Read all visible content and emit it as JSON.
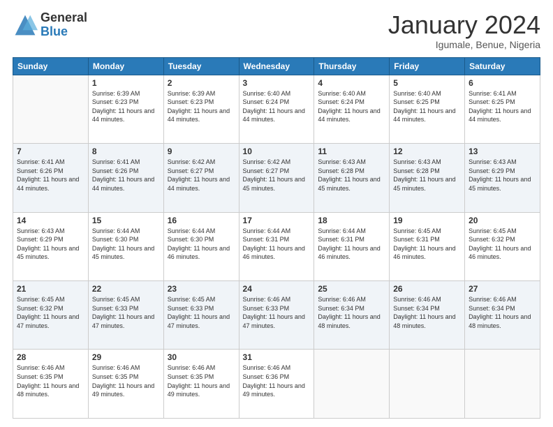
{
  "logo": {
    "general": "General",
    "blue": "Blue"
  },
  "header": {
    "month": "January 2024",
    "location": "Igumale, Benue, Nigeria"
  },
  "weekdays": [
    "Sunday",
    "Monday",
    "Tuesday",
    "Wednesday",
    "Thursday",
    "Friday",
    "Saturday"
  ],
  "weeks": [
    [
      {
        "day": "",
        "sunrise": "",
        "sunset": "",
        "daylight": ""
      },
      {
        "day": "1",
        "sunrise": "Sunrise: 6:39 AM",
        "sunset": "Sunset: 6:23 PM",
        "daylight": "Daylight: 11 hours and 44 minutes."
      },
      {
        "day": "2",
        "sunrise": "Sunrise: 6:39 AM",
        "sunset": "Sunset: 6:23 PM",
        "daylight": "Daylight: 11 hours and 44 minutes."
      },
      {
        "day": "3",
        "sunrise": "Sunrise: 6:40 AM",
        "sunset": "Sunset: 6:24 PM",
        "daylight": "Daylight: 11 hours and 44 minutes."
      },
      {
        "day": "4",
        "sunrise": "Sunrise: 6:40 AM",
        "sunset": "Sunset: 6:24 PM",
        "daylight": "Daylight: 11 hours and 44 minutes."
      },
      {
        "day": "5",
        "sunrise": "Sunrise: 6:40 AM",
        "sunset": "Sunset: 6:25 PM",
        "daylight": "Daylight: 11 hours and 44 minutes."
      },
      {
        "day": "6",
        "sunrise": "Sunrise: 6:41 AM",
        "sunset": "Sunset: 6:25 PM",
        "daylight": "Daylight: 11 hours and 44 minutes."
      }
    ],
    [
      {
        "day": "7",
        "sunrise": "Sunrise: 6:41 AM",
        "sunset": "Sunset: 6:26 PM",
        "daylight": "Daylight: 11 hours and 44 minutes."
      },
      {
        "day": "8",
        "sunrise": "Sunrise: 6:41 AM",
        "sunset": "Sunset: 6:26 PM",
        "daylight": "Daylight: 11 hours and 44 minutes."
      },
      {
        "day": "9",
        "sunrise": "Sunrise: 6:42 AM",
        "sunset": "Sunset: 6:27 PM",
        "daylight": "Daylight: 11 hours and 44 minutes."
      },
      {
        "day": "10",
        "sunrise": "Sunrise: 6:42 AM",
        "sunset": "Sunset: 6:27 PM",
        "daylight": "Daylight: 11 hours and 45 minutes."
      },
      {
        "day": "11",
        "sunrise": "Sunrise: 6:43 AM",
        "sunset": "Sunset: 6:28 PM",
        "daylight": "Daylight: 11 hours and 45 minutes."
      },
      {
        "day": "12",
        "sunrise": "Sunrise: 6:43 AM",
        "sunset": "Sunset: 6:28 PM",
        "daylight": "Daylight: 11 hours and 45 minutes."
      },
      {
        "day": "13",
        "sunrise": "Sunrise: 6:43 AM",
        "sunset": "Sunset: 6:29 PM",
        "daylight": "Daylight: 11 hours and 45 minutes."
      }
    ],
    [
      {
        "day": "14",
        "sunrise": "Sunrise: 6:43 AM",
        "sunset": "Sunset: 6:29 PM",
        "daylight": "Daylight: 11 hours and 45 minutes."
      },
      {
        "day": "15",
        "sunrise": "Sunrise: 6:44 AM",
        "sunset": "Sunset: 6:30 PM",
        "daylight": "Daylight: 11 hours and 45 minutes."
      },
      {
        "day": "16",
        "sunrise": "Sunrise: 6:44 AM",
        "sunset": "Sunset: 6:30 PM",
        "daylight": "Daylight: 11 hours and 46 minutes."
      },
      {
        "day": "17",
        "sunrise": "Sunrise: 6:44 AM",
        "sunset": "Sunset: 6:31 PM",
        "daylight": "Daylight: 11 hours and 46 minutes."
      },
      {
        "day": "18",
        "sunrise": "Sunrise: 6:44 AM",
        "sunset": "Sunset: 6:31 PM",
        "daylight": "Daylight: 11 hours and 46 minutes."
      },
      {
        "day": "19",
        "sunrise": "Sunrise: 6:45 AM",
        "sunset": "Sunset: 6:31 PM",
        "daylight": "Daylight: 11 hours and 46 minutes."
      },
      {
        "day": "20",
        "sunrise": "Sunrise: 6:45 AM",
        "sunset": "Sunset: 6:32 PM",
        "daylight": "Daylight: 11 hours and 46 minutes."
      }
    ],
    [
      {
        "day": "21",
        "sunrise": "Sunrise: 6:45 AM",
        "sunset": "Sunset: 6:32 PM",
        "daylight": "Daylight: 11 hours and 47 minutes."
      },
      {
        "day": "22",
        "sunrise": "Sunrise: 6:45 AM",
        "sunset": "Sunset: 6:33 PM",
        "daylight": "Daylight: 11 hours and 47 minutes."
      },
      {
        "day": "23",
        "sunrise": "Sunrise: 6:45 AM",
        "sunset": "Sunset: 6:33 PM",
        "daylight": "Daylight: 11 hours and 47 minutes."
      },
      {
        "day": "24",
        "sunrise": "Sunrise: 6:46 AM",
        "sunset": "Sunset: 6:33 PM",
        "daylight": "Daylight: 11 hours and 47 minutes."
      },
      {
        "day": "25",
        "sunrise": "Sunrise: 6:46 AM",
        "sunset": "Sunset: 6:34 PM",
        "daylight": "Daylight: 11 hours and 48 minutes."
      },
      {
        "day": "26",
        "sunrise": "Sunrise: 6:46 AM",
        "sunset": "Sunset: 6:34 PM",
        "daylight": "Daylight: 11 hours and 48 minutes."
      },
      {
        "day": "27",
        "sunrise": "Sunrise: 6:46 AM",
        "sunset": "Sunset: 6:34 PM",
        "daylight": "Daylight: 11 hours and 48 minutes."
      }
    ],
    [
      {
        "day": "28",
        "sunrise": "Sunrise: 6:46 AM",
        "sunset": "Sunset: 6:35 PM",
        "daylight": "Daylight: 11 hours and 48 minutes."
      },
      {
        "day": "29",
        "sunrise": "Sunrise: 6:46 AM",
        "sunset": "Sunset: 6:35 PM",
        "daylight": "Daylight: 11 hours and 49 minutes."
      },
      {
        "day": "30",
        "sunrise": "Sunrise: 6:46 AM",
        "sunset": "Sunset: 6:35 PM",
        "daylight": "Daylight: 11 hours and 49 minutes."
      },
      {
        "day": "31",
        "sunrise": "Sunrise: 6:46 AM",
        "sunset": "Sunset: 6:36 PM",
        "daylight": "Daylight: 11 hours and 49 minutes."
      },
      {
        "day": "",
        "sunrise": "",
        "sunset": "",
        "daylight": ""
      },
      {
        "day": "",
        "sunrise": "",
        "sunset": "",
        "daylight": ""
      },
      {
        "day": "",
        "sunrise": "",
        "sunset": "",
        "daylight": ""
      }
    ]
  ]
}
